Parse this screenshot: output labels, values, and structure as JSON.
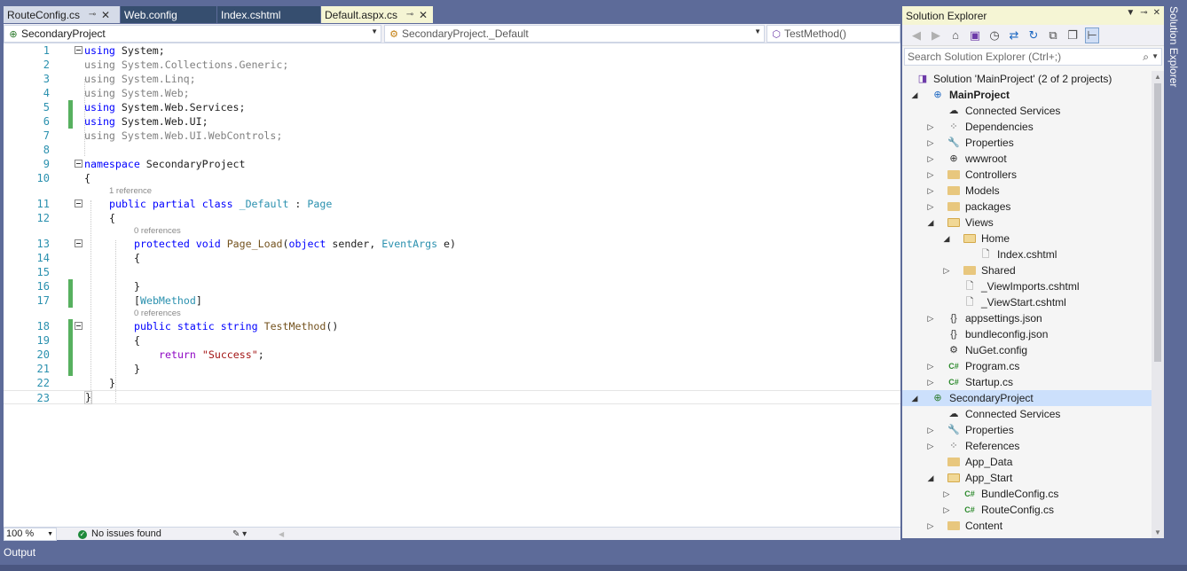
{
  "doc_tabs": [
    {
      "label": "RouteConfig.cs",
      "pin": "⊸",
      "close": "✕"
    },
    {
      "label": "Web.config"
    },
    {
      "label": "Index.cshtml"
    },
    {
      "label": "Default.aspx.cs",
      "pin": "⊸",
      "close": "✕"
    }
  ],
  "editor": {
    "nav": {
      "project": "SecondaryProject",
      "class": "SecondaryProject._Default",
      "member": "TestMethod()"
    },
    "lines": [
      {
        "n": "1",
        "code": "using System;"
      },
      {
        "n": "2",
        "code": "using System.Collections.Generic;"
      },
      {
        "n": "3",
        "code": "using System.Linq;"
      },
      {
        "n": "4",
        "code": "using System.Web;"
      },
      {
        "n": "5",
        "code": "using System.Web.Services;"
      },
      {
        "n": "6",
        "code": "using System.Web.UI;"
      },
      {
        "n": "7",
        "code": "using System.Web.UI.WebControls;"
      },
      {
        "n": "8",
        "code": ""
      },
      {
        "n": "9",
        "code": "namespace SecondaryProject"
      },
      {
        "n": "10",
        "code": "{"
      },
      {
        "n": "11",
        "code": "public partial class _Default : Page"
      },
      {
        "n": "12",
        "code": "{"
      },
      {
        "n": "13",
        "code": "protected void Page_Load(object sender, EventArgs e)"
      },
      {
        "n": "14",
        "code": "{"
      },
      {
        "n": "15",
        "code": ""
      },
      {
        "n": "16",
        "code": "}"
      },
      {
        "n": "17",
        "code": "[WebMethod]"
      },
      {
        "n": "18",
        "code": "public static string TestMethod()"
      },
      {
        "n": "19",
        "code": "{"
      },
      {
        "n": "20",
        "code": "return \"Success\";"
      },
      {
        "n": "21",
        "code": "}"
      },
      {
        "n": "22",
        "code": "}"
      },
      {
        "n": "23",
        "code": "}"
      }
    ],
    "lens": {
      "class_refs": "1 reference",
      "page_load_refs": "0 references",
      "testmethod_refs": "0 references"
    },
    "zoom": "100 %",
    "issues": "No issues found"
  },
  "solution_explorer": {
    "title": "Solution Explorer",
    "search_placeholder": "Search Solution Explorer (Ctrl+;)",
    "side_tab": "Solution Explorer",
    "tree": [
      {
        "label": "Solution 'MainProject' (2 of 2 projects)",
        "icon": "solution-icon"
      },
      {
        "label": "MainProject",
        "icon": "web-project-icon"
      },
      {
        "label": "Connected Services",
        "icon": "connected-services-icon"
      },
      {
        "label": "Dependencies",
        "icon": "dependencies-icon"
      },
      {
        "label": "Properties",
        "icon": "properties-icon"
      },
      {
        "label": "wwwroot",
        "icon": "globe-icon"
      },
      {
        "label": "Controllers",
        "icon": "folder-icon"
      },
      {
        "label": "Models",
        "icon": "folder-icon"
      },
      {
        "label": "packages",
        "icon": "folder-icon"
      },
      {
        "label": "Views",
        "icon": "folder-open-icon"
      },
      {
        "label": "Home",
        "icon": "folder-open-icon"
      },
      {
        "label": "Index.cshtml",
        "icon": "file-icon"
      },
      {
        "label": "Shared",
        "icon": "folder-icon"
      },
      {
        "label": "_ViewImports.cshtml",
        "icon": "file-icon"
      },
      {
        "label": "_ViewStart.cshtml",
        "icon": "file-icon"
      },
      {
        "label": "appsettings.json",
        "icon": "json-icon"
      },
      {
        "label": "bundleconfig.json",
        "icon": "json-icon"
      },
      {
        "label": "NuGet.config",
        "icon": "config-icon"
      },
      {
        "label": "Program.cs",
        "icon": "csharp-icon"
      },
      {
        "label": "Startup.cs",
        "icon": "csharp-icon"
      },
      {
        "label": "SecondaryProject",
        "icon": "web-project-icon"
      },
      {
        "label": "Connected Services",
        "icon": "connected-services-icon"
      },
      {
        "label": "Properties",
        "icon": "wrench-icon"
      },
      {
        "label": "References",
        "icon": "references-icon"
      },
      {
        "label": "App_Data",
        "icon": "folder-icon"
      },
      {
        "label": "App_Start",
        "icon": "folder-open-icon"
      },
      {
        "label": "BundleConfig.cs",
        "icon": "csharp-icon"
      },
      {
        "label": "RouteConfig.cs",
        "icon": "csharp-icon"
      },
      {
        "label": "Content",
        "icon": "folder-icon"
      }
    ]
  },
  "output": {
    "label": "Output"
  },
  "colors": {
    "chrome": "#5d6b99",
    "active_tab": "#f5f5d4",
    "keyword": "#0000ff",
    "type": "#2b91af",
    "string": "#a31515",
    "change_bar": "#57b05f",
    "selection": "#cce0fc"
  }
}
